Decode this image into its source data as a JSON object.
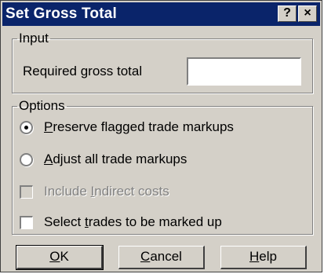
{
  "window": {
    "title": "Set Gross Total",
    "help_glyph": "?",
    "close_glyph": "×"
  },
  "input_group": {
    "legend": "Input",
    "gross_label": "Required gross total",
    "gross_value": ""
  },
  "options_group": {
    "legend": "Options",
    "preserve": {
      "pre": "",
      "key": "P",
      "post": "reserve flagged trade markups",
      "selected": true
    },
    "adjust": {
      "pre": "",
      "key": "A",
      "post": "djust all trade markups",
      "selected": false
    },
    "indirect": {
      "pre": "Include ",
      "key": "I",
      "post": "ndirect costs",
      "checked": false,
      "disabled": true
    },
    "select": {
      "pre": "Select ",
      "key": "t",
      "post": "rades to be marked up",
      "checked": false,
      "disabled": false
    }
  },
  "buttons": {
    "ok": {
      "key": "O",
      "post": "K"
    },
    "cancel": {
      "key": "C",
      "post": "ancel"
    },
    "help": {
      "key": "H",
      "post": "elp"
    }
  }
}
